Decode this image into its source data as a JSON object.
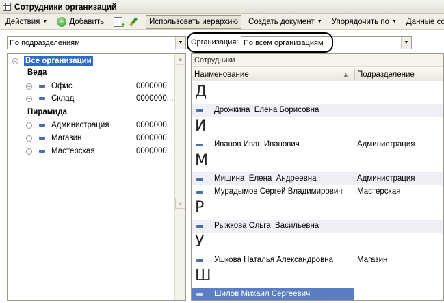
{
  "window": {
    "title": "Сотрудники организаций"
  },
  "toolbar": {
    "actions": "Действия",
    "add": "Добавить",
    "use_hierarchy": "Использовать иерархию",
    "create_document": "Создать документ",
    "sort_by": "Упорядочить по",
    "employee_data": "Данные сотрудника"
  },
  "filters": {
    "grouping_value": "По подразделениям",
    "organization_label": "Организация:",
    "organization_value": "По всем организациям"
  },
  "tree": {
    "root": "Все организации",
    "groups": [
      {
        "name": "Веда",
        "items": [
          {
            "label": "Офис",
            "code": "0000000..."
          },
          {
            "label": "Склад",
            "code": "0000000..."
          }
        ]
      },
      {
        "name": "Пирамида",
        "items": [
          {
            "label": "Администрация",
            "code": "0000000..."
          },
          {
            "label": "Магазин",
            "code": "0000000..."
          },
          {
            "label": "Мастерская",
            "code": "0000000..."
          }
        ]
      }
    ]
  },
  "employees": {
    "panel_title": "Сотрудники",
    "columns": {
      "name": "Наименование",
      "department": "Подразделение"
    },
    "letters": [
      "Д",
      "И",
      "М",
      "Р",
      "У",
      "Ш"
    ],
    "rows": [
      {
        "name": "Дрожкина  Елена Борисовна",
        "department": ""
      },
      {
        "name": "Иванов Иван Иванович",
        "department": "Администрация"
      },
      {
        "name": "Мишина  Елена  Андреевна",
        "department": "Администрация"
      },
      {
        "name": "Мурадымов Сергей Владимирович",
        "department": "Мастерская"
      },
      {
        "name": "Рыжкова Ольга  Васильевна",
        "department": ""
      },
      {
        "name": "Ушкова Наталья Александровна",
        "department": "Магазин"
      },
      {
        "name": "Шилов Михаил Сергеевич",
        "department": ""
      }
    ]
  },
  "colors": {
    "selection": "#316ac5",
    "row_selection": "#5b7ec2",
    "item_marker": "#4a6fa8"
  }
}
